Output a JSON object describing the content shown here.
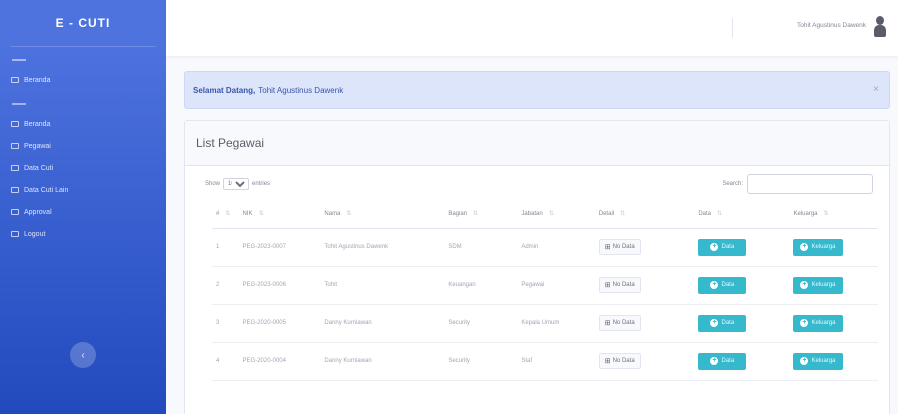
{
  "brand": "E - CUTI",
  "sidebar": {
    "items": [
      {
        "label": "Beranda"
      },
      {
        "label": "Beranda"
      },
      {
        "label": "Pegawai"
      },
      {
        "label": "Data Cuti"
      },
      {
        "label": "Data Cuti Lain"
      },
      {
        "label": "Approval"
      },
      {
        "label": "Logout"
      }
    ]
  },
  "topbar": {
    "user_name": "Tohit Agustinus Dawenk"
  },
  "alert": {
    "bold": "Selamat Datang,",
    "text": "Tohit Agustinus Dawenk",
    "close": "×"
  },
  "card": {
    "title": "List Pegawai"
  },
  "controls": {
    "show": "Show",
    "entries_value": "10",
    "entries": "entries",
    "search_label": "Search:"
  },
  "table": {
    "headers": [
      "#",
      "NIK",
      "Nama",
      "Bagian",
      "Jabatan",
      "Detail",
      "Data",
      "Keluarga"
    ],
    "no_data_label": "No Data",
    "data_label": "Data",
    "keluarga_label": "Keluarga",
    "rows": [
      {
        "no": "1",
        "nik": "PEG-2023-0007",
        "nama": "Tohit Agustinus Dawenk",
        "bagian": "SDM",
        "jabatan": "Admin"
      },
      {
        "no": "2",
        "nik": "PEG-2023-0006",
        "nama": "Tohit",
        "bagian": "Keuangan",
        "jabatan": "Pegawai"
      },
      {
        "no": "3",
        "nik": "PEG-2020-0005",
        "nama": "Danny Kurniawan",
        "bagian": "Security",
        "jabatan": "Kepala Umum"
      },
      {
        "no": "4",
        "nik": "PEG-2020-0004",
        "nama": "Danny Kurniawan",
        "bagian": "Security",
        "jabatan": "Staf"
      }
    ]
  }
}
